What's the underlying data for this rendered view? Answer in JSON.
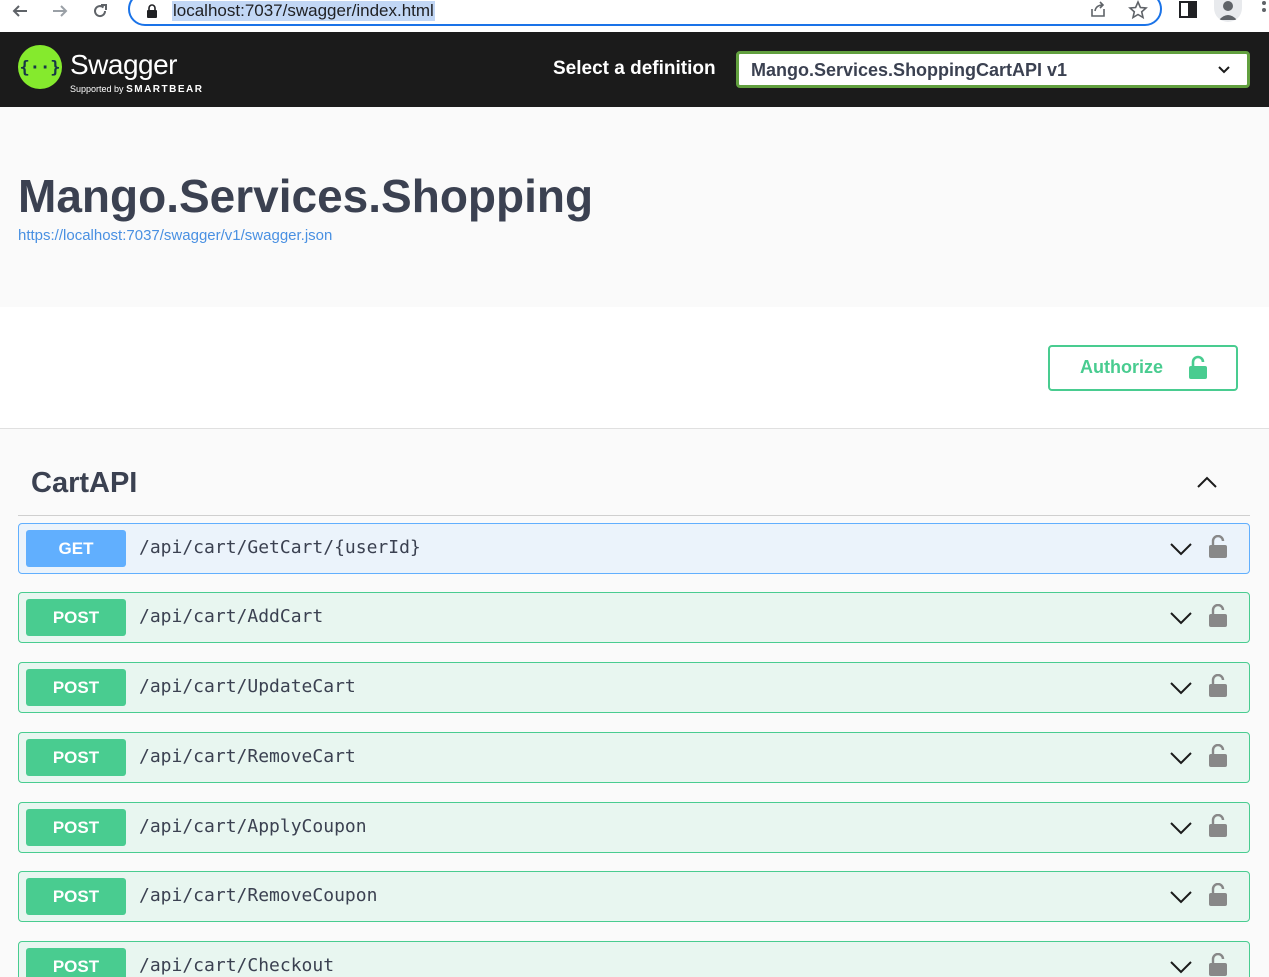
{
  "browser": {
    "url": "localhost:7037/swagger/index.html"
  },
  "topbar": {
    "logo_text": "Swagger",
    "logo_sub_prefix": "Supported by",
    "logo_sub_brand": "SMARTBEAR",
    "definition_label": "Select a definition",
    "definition_selected": "Mango.Services.ShoppingCartAPI v1"
  },
  "info": {
    "title": "Mango.Services.Shopping",
    "spec_url": "https://localhost:7037/swagger/v1/swagger.json"
  },
  "auth": {
    "label": "Authorize"
  },
  "tag": {
    "name": "CartAPI",
    "operations": [
      {
        "method": "GET",
        "path": "/api/cart/GetCart/{userId}"
      },
      {
        "method": "POST",
        "path": "/api/cart/AddCart"
      },
      {
        "method": "POST",
        "path": "/api/cart/UpdateCart"
      },
      {
        "method": "POST",
        "path": "/api/cart/RemoveCart"
      },
      {
        "method": "POST",
        "path": "/api/cart/ApplyCoupon"
      },
      {
        "method": "POST",
        "path": "/api/cart/RemoveCoupon"
      },
      {
        "method": "POST",
        "path": "/api/cart/Checkout"
      }
    ]
  },
  "colors": {
    "get": "#61affe",
    "post": "#49cc90",
    "swagger_green": "#85ea2d",
    "topbar": "#1b1b1b"
  }
}
